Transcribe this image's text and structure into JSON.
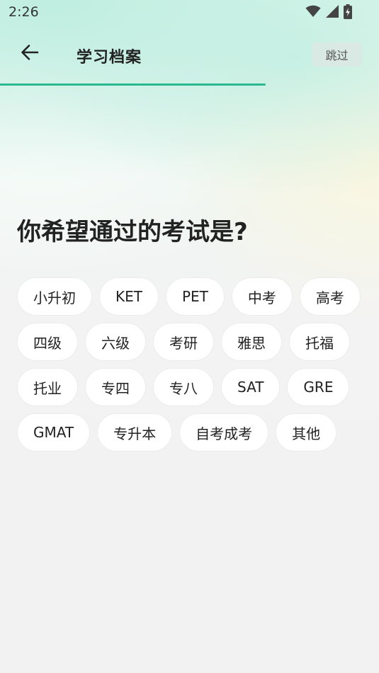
{
  "status_bar": {
    "time": "2:26",
    "icons": [
      "wifi-icon",
      "cellular-signal-icon",
      "battery-charging-icon"
    ]
  },
  "header": {
    "back_icon": "arrow-left-icon",
    "title": "学习档案",
    "skip_label": "跳过"
  },
  "progress": {
    "value": 0.75,
    "color": "#2ab98f"
  },
  "question": "你希望通过的考试是?",
  "options": [
    {
      "label": "小升初"
    },
    {
      "label": "KET"
    },
    {
      "label": "PET"
    },
    {
      "label": "中考"
    },
    {
      "label": "高考"
    },
    {
      "label": "四级"
    },
    {
      "label": "六级"
    },
    {
      "label": "考研"
    },
    {
      "label": "雅思"
    },
    {
      "label": "托福"
    },
    {
      "label": "托业"
    },
    {
      "label": "专四"
    },
    {
      "label": "专八"
    },
    {
      "label": "SAT"
    },
    {
      "label": "GRE"
    },
    {
      "label": "GMAT"
    },
    {
      "label": "专升本"
    },
    {
      "label": "自考成考"
    },
    {
      "label": "其他"
    }
  ]
}
